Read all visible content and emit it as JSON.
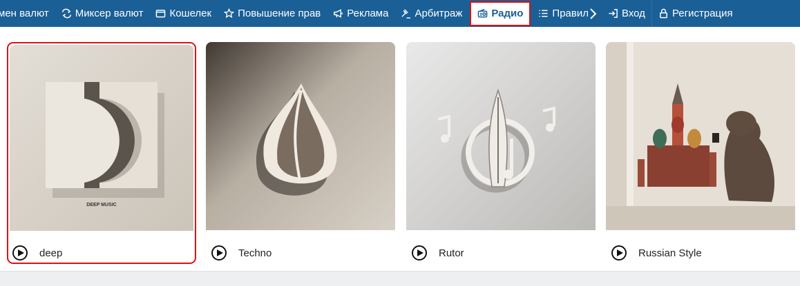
{
  "nav": {
    "items": [
      {
        "label": "мен валют",
        "icon": "none"
      },
      {
        "label": "Миксер валют",
        "icon": "repeat-icon"
      },
      {
        "label": "Кошелек",
        "icon": "wallet-icon"
      },
      {
        "label": "Повышение прав",
        "icon": "star-icon"
      },
      {
        "label": "Реклама",
        "icon": "megaphone-icon"
      },
      {
        "label": "Арбитраж",
        "icon": "gavel-icon"
      },
      {
        "label": "Радио",
        "icon": "radio-icon"
      },
      {
        "label": "Правил",
        "icon": "list-icon"
      }
    ],
    "login": "Вход",
    "register": "Регистрация"
  },
  "stations": [
    {
      "title": "deep",
      "image_caption": "DEEP MUSIC"
    },
    {
      "title": "Techno"
    },
    {
      "title": "Rutor"
    },
    {
      "title": "Russian Style"
    }
  ],
  "colors": {
    "navbar": "#1a5f96",
    "highlight": "#e01010",
    "footer": "#eeeff1"
  }
}
